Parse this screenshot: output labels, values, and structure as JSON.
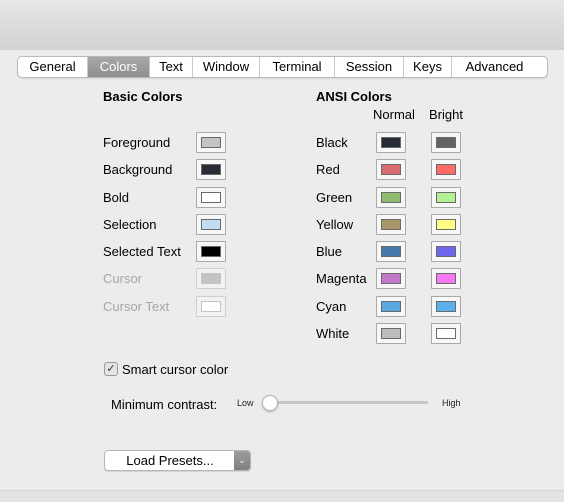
{
  "tabs": [
    {
      "label": "General",
      "active": false
    },
    {
      "label": "Colors",
      "active": true
    },
    {
      "label": "Text",
      "active": false
    },
    {
      "label": "Window",
      "active": false
    },
    {
      "label": "Terminal",
      "active": false
    },
    {
      "label": "Session",
      "active": false
    },
    {
      "label": "Keys",
      "active": false
    },
    {
      "label": "Advanced",
      "active": false
    }
  ],
  "basic": {
    "heading": "Basic Colors",
    "items": [
      {
        "label": "Foreground",
        "color": "#c3c3c3",
        "enabled": true
      },
      {
        "label": "Background",
        "color": "#272b33",
        "enabled": true
      },
      {
        "label": "Bold",
        "color": "#ffffff",
        "enabled": true
      },
      {
        "label": "Selection",
        "color": "#c2dcf4",
        "enabled": true
      },
      {
        "label": "Selected Text",
        "color": "#000000",
        "enabled": true
      },
      {
        "label": "Cursor",
        "color": "#c3c3c3",
        "enabled": false
      },
      {
        "label": "Cursor Text",
        "color": "#ffffff",
        "enabled": false
      }
    ]
  },
  "ansi": {
    "heading": "ANSI Colors",
    "normal_label": "Normal",
    "bright_label": "Bright",
    "items": [
      {
        "label": "Black",
        "normal": "#272b33",
        "bright": "#636363"
      },
      {
        "label": "Red",
        "normal": "#d96c73",
        "bright": "#fe6b64"
      },
      {
        "label": "Green",
        "normal": "#8fbb6e",
        "bright": "#b5ef96"
      },
      {
        "label": "Yellow",
        "normal": "#a9966b",
        "bright": "#fefd84"
      },
      {
        "label": "Blue",
        "normal": "#467aac",
        "bright": "#6c66ef"
      },
      {
        "label": "Magenta",
        "normal": "#c07ac9",
        "bright": "#f779f1"
      },
      {
        "label": "Cyan",
        "normal": "#5ba7e1",
        "bright": "#5bafeb"
      },
      {
        "label": "White",
        "normal": "#bdbdbd",
        "bright": "#ffffff"
      }
    ]
  },
  "smart_cursor": {
    "label": "Smart cursor color",
    "checked": true,
    "check_glyph": "✓"
  },
  "min_contrast": {
    "label": "Minimum contrast:",
    "low": "Low",
    "high": "High",
    "value": 0.0
  },
  "presets": {
    "label": "Load Presets...",
    "arrow_glyph": "⌄"
  }
}
